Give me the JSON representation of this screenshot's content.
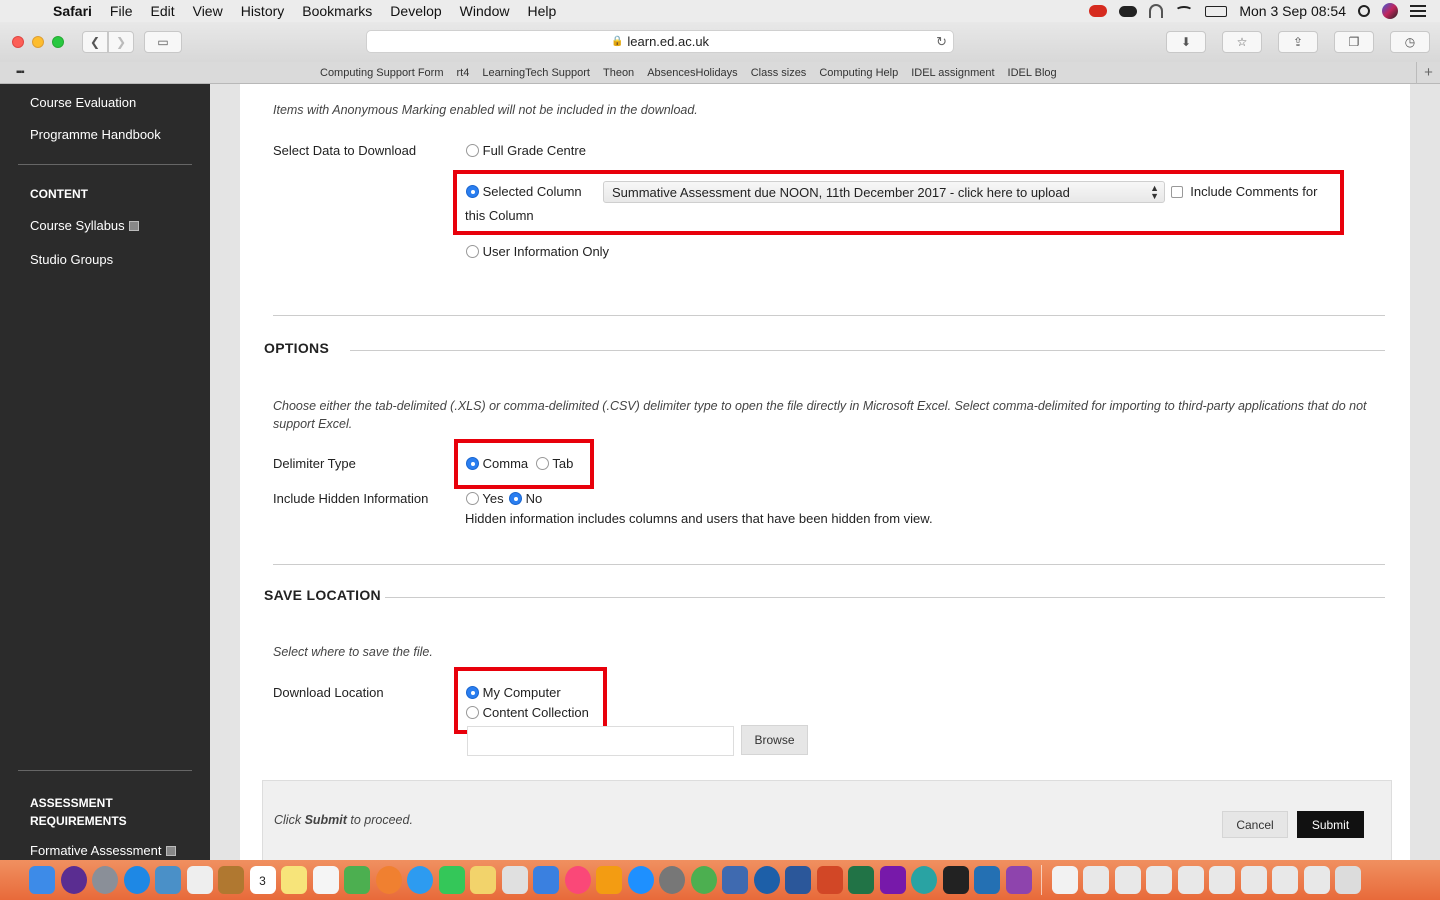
{
  "menubar": {
    "app": "Safari",
    "items": [
      "File",
      "Edit",
      "View",
      "History",
      "Bookmarks",
      "Develop",
      "Window",
      "Help"
    ],
    "clock": "Mon 3 Sep  08:54"
  },
  "browser": {
    "url": "learn.ed.ac.uk",
    "bookmarks": [
      "Computing Support Form",
      "rt4",
      "LearningTech Support",
      "Theon",
      "AbsencesHolidays",
      "Class sizes",
      "Computing Help",
      "IDEL assignment",
      "IDEL Blog"
    ]
  },
  "course_nav": {
    "links_top": [
      "Course Evaluation",
      "Programme Handbook"
    ],
    "content_heading": "CONTENT",
    "content_links": [
      "Course Syllabus",
      "Studio Groups"
    ],
    "assessment_heading": "ASSESSMENT REQUIREMENTS",
    "assessment_links": [
      "Formative Assessment"
    ]
  },
  "form": {
    "anonymous_note": "Items with Anonymous Marking enabled will not be included in the download.",
    "select_data_label": "Select Data to Download",
    "opt_full_grade": "Full Grade Centre",
    "opt_selected_column": "Selected Column",
    "column_select_value": "Summative Assessment due NOON, 11th December 2017 - click here to upload",
    "include_comments_label": "Include Comments for",
    "include_comments_label_2": "this Column",
    "opt_user_info": "User Information Only",
    "options_title": "OPTIONS",
    "options_note": "Choose either the tab-delimited (.XLS) or comma-delimited (.CSV) delimiter type to open the file directly in Microsoft Excel. Select comma-delimited for importing to third-party applications that do not support Excel.",
    "delimiter_label": "Delimiter Type",
    "delim_comma": "Comma",
    "delim_tab": "Tab",
    "hidden_label": "Include Hidden Information",
    "hidden_yes": "Yes",
    "hidden_no": "No",
    "hidden_note": "Hidden information includes columns and users that have been hidden from view.",
    "save_title": "SAVE LOCATION",
    "save_note": "Select where to save the file.",
    "download_location_label": "Download Location",
    "loc_my_computer": "My Computer",
    "loc_content_collection": "Content Collection",
    "browse_label": "Browse",
    "submit_note_pre": "Click ",
    "submit_note_bold": "Submit",
    "submit_note_post": " to proceed.",
    "cancel_label": "Cancel",
    "submit_label": "Submit"
  },
  "dock": {
    "calendar_day": "3"
  },
  "colors": {
    "highlight": "#e8000b",
    "radio_selected": "#2a7ef0",
    "nav_bg": "#2b2b2b"
  }
}
